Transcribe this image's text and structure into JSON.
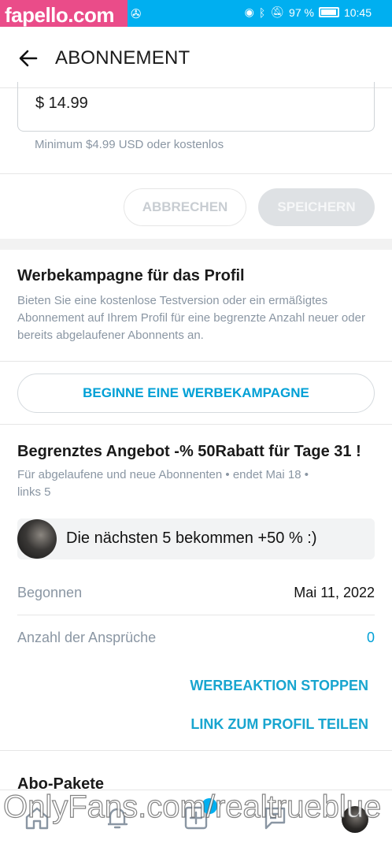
{
  "status_bar": {
    "watermark": "fapello.com",
    "battery": "97 %",
    "time": "10:45"
  },
  "header": {
    "title": "ABONNEMENT",
    "back_icon": "arrow-left-icon"
  },
  "price": {
    "value": "$  14.99",
    "hint": "Minimum $4.99 USD oder kostenlos"
  },
  "actions": {
    "cancel_label": "ABBRECHEN",
    "save_label": "SPEICHERN"
  },
  "promo": {
    "title": "Werbekampagne für das Profil",
    "description": "Bieten Sie eine kostenlose Testversion oder ein ermäßigtes Abonnement auf Ihrem Profil für eine begrenzte Anzahl neuer oder bereits abgelaufener Abonnents an.",
    "start_button": "BEGINNE EINE WERBEKAMPAGNE"
  },
  "offer": {
    "title": "Begrenztes Angebot -% 50Rabatt für Tage 31 !",
    "meta_line1": "Für abgelaufene und neue Abonnenten  •  endet Mai 18  •",
    "meta_line2": "links 5",
    "message": "Die nächsten 5 bekommen +50 % :)",
    "rows": [
      {
        "label": "Begonnen",
        "value": "Mai 11, 2022"
      },
      {
        "label": "Anzahl der Ansprüche",
        "value": "0"
      }
    ],
    "stop_link": "WERBEAKTION STOPPEN",
    "share_link": "LINK ZUM PROFIL TEILEN"
  },
  "packages": {
    "title": "Abo-Pakete"
  },
  "bottom_nav": {
    "items": [
      "home-icon",
      "bell-icon",
      "plus-square-icon",
      "chat-icon",
      "avatar"
    ]
  },
  "overlay_watermark": "OnlyFans.com/realtrueblue",
  "colors": {
    "accent": "#00aff0",
    "link": "#00a0d6",
    "muted": "#8a96a3",
    "watermark_pink": "#ea4c89"
  }
}
